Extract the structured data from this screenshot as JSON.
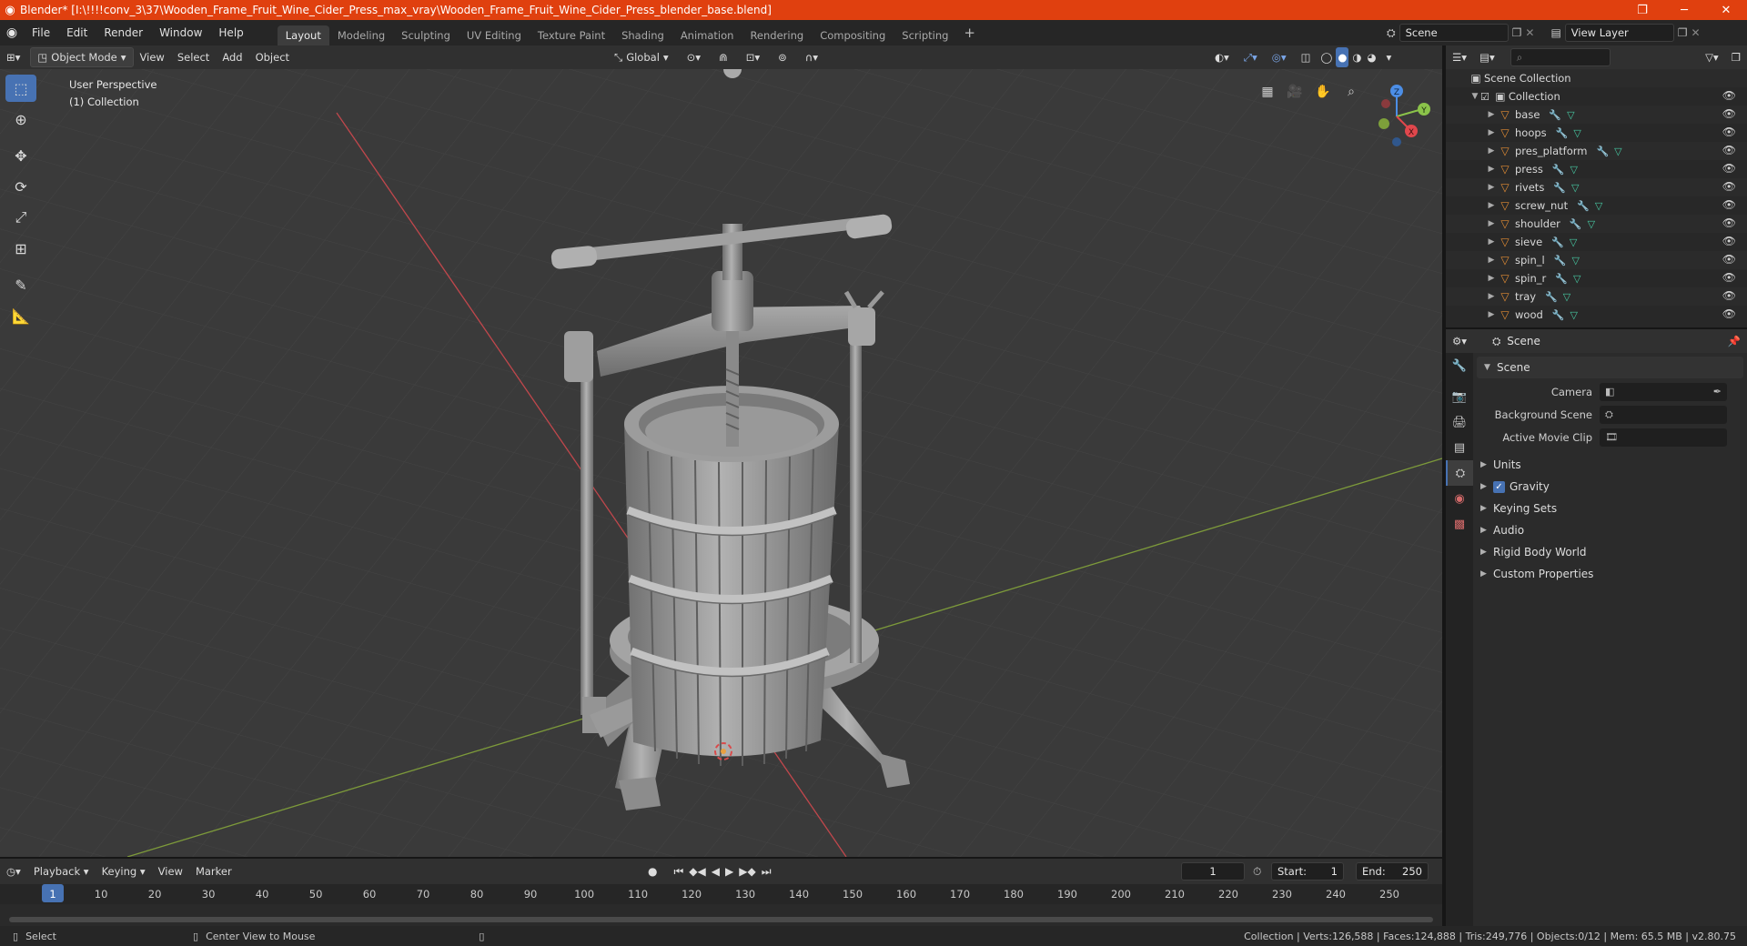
{
  "window": {
    "title": "Blender* [I:\\!!!!conv_3\\37\\Wooden_Frame_Fruit_Wine_Cider_Press_max_vray\\Wooden_Frame_Fruit_Wine_Cider_Press_blender_base.blend]",
    "minimize_icon": "─",
    "maximize_icon": "❐",
    "close_icon": "✕"
  },
  "menu": [
    "File",
    "Edit",
    "Render",
    "Window",
    "Help"
  ],
  "workspaces": [
    "Layout",
    "Modeling",
    "Sculpting",
    "UV Editing",
    "Texture Paint",
    "Shading",
    "Animation",
    "Rendering",
    "Compositing",
    "Scripting"
  ],
  "scene_field": "Scene",
  "view_layer_field": "View Layer",
  "viewport_header": {
    "mode": "Object Mode",
    "menus": [
      "View",
      "Select",
      "Add",
      "Object"
    ],
    "orientation": "Global"
  },
  "viewport": {
    "perspective": "User Perspective",
    "collection": "(1) Collection",
    "axis_labels": {
      "x": "X",
      "y": "Y",
      "z": "Z"
    }
  },
  "outliner": {
    "root": "Scene Collection",
    "collection": "Collection",
    "objects": [
      "base",
      "hoops",
      "pres_platform",
      "press",
      "rivets",
      "screw_nut",
      "shoulder",
      "sieve",
      "spin_l",
      "spin_r",
      "tray",
      "wood"
    ]
  },
  "properties": {
    "header": "Scene",
    "section": "Scene",
    "fields": [
      {
        "label": "Camera",
        "value": ""
      },
      {
        "label": "Background Scene",
        "value": ""
      },
      {
        "label": "Active Movie Clip",
        "value": ""
      }
    ],
    "panels": [
      "Units",
      "Gravity",
      "Keying Sets",
      "Audio",
      "Rigid Body World",
      "Custom Properties"
    ],
    "gravity_checked": true
  },
  "timeline": {
    "menus": [
      "Playback",
      "Keying",
      "View",
      "Marker"
    ],
    "current_frame": "1",
    "start_label": "Start:",
    "start": "1",
    "end_label": "End:",
    "end": "250",
    "frames": [
      "1",
      "10",
      "20",
      "30",
      "40",
      "50",
      "60",
      "70",
      "80",
      "90",
      "100",
      "110",
      "120",
      "130",
      "140",
      "150",
      "160",
      "170",
      "180",
      "190",
      "200",
      "210",
      "220",
      "230",
      "240",
      "250"
    ]
  },
  "statusbar": {
    "left": "Select",
    "middle": "Center View to Mouse",
    "right": "Collection | Verts:126,588 | Faces:124,888 | Tris:249,776 | Objects:0/12 | Mem: 65.5 MB | v2.80.75"
  },
  "colors": {
    "accent": "#4772b3",
    "titlebar": "#e0400f",
    "x_axis": "#e0474c",
    "y_axis": "#8bc34a",
    "z_axis": "#4c8ee6",
    "object_icon": "#e08b34"
  }
}
